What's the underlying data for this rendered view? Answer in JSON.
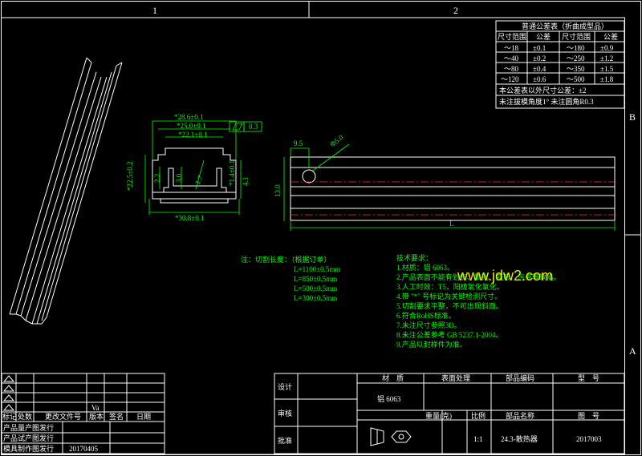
{
  "frame": {
    "zone_1": "1",
    "zone_2": "2",
    "zone_A": "A",
    "zone_B": "B"
  },
  "tolerance_table": {
    "title": "普通公差表（折曲成型品）",
    "headers": [
      "尺寸范围",
      "公差",
      "尺寸范围",
      "公差"
    ],
    "rows": [
      [
        "～18",
        "±0.1",
        "～180",
        "±0.9"
      ],
      [
        "～40",
        "±0.2",
        "～250",
        "±1.2"
      ],
      [
        "～80",
        "±0.4",
        "～350",
        "±1.5"
      ],
      [
        "～120",
        "±0.6",
        "～500",
        "±1.8"
      ]
    ],
    "note1": "本公差表以外尺寸公差：±2",
    "note2": "未注拔模角度1° 未注圆角R0.3"
  },
  "section_view": {
    "dims": [
      "*28.6±0.1",
      "*25.0±0.1",
      "*22.1±0.1",
      "*22.5±0.2",
      "2.2",
      "3.0",
      "1.7",
      "*1.4±0.1",
      "4.1",
      "*30.8±0.1"
    ],
    "flatness_value": "0.3"
  },
  "side_view": {
    "dims": [
      "9.5",
      "Φ5.0",
      "13.0",
      "L"
    ]
  },
  "cut_length": {
    "title": "注：切割长度：（根据订单）",
    "items": [
      "L=1100±0.5mm",
      "L=850±0.5mm",
      "L=500±0.5mm",
      "L=300±0.5mm"
    ]
  },
  "tech_req": {
    "title": "技术要求：",
    "items": [
      "1.材质：铝 6063。",
      "2.产品表面不能有划伤、氧化、变形、污点等缺陷。",
      "3.人工时效：T5，阳极氧化氧化。",
      "4.带 \"*\" 号标记为关键检测尺寸。",
      "5.切割要求平整，不可出现斜面。",
      "6.符合RoHS标准。",
      "7.未注尺寸参照3D。",
      "8.未注公差参考 GB 5237.1-2004。",
      "9.产品以封样件为准。"
    ]
  },
  "watermark": "www.jdw2.com",
  "revision_block": {
    "headers": [
      "标记",
      "处数",
      "更改文件号",
      "版本",
      "签名",
      "日期"
    ],
    "version": "Va",
    "rows": [
      {
        "label": "产品量产图发行",
        "date": ""
      },
      {
        "label": "产品试产图发行",
        "date": ""
      },
      {
        "label": "模具制作图发行",
        "date": "20170405"
      }
    ]
  },
  "title_block": {
    "design": "设计",
    "review": "审核",
    "approve": "批准",
    "material_h": "材　质",
    "surface_h": "表面处理",
    "part_no_h": "部品编码",
    "model_h": "型　号",
    "material_v": "铝 6063",
    "weight_h": "重量(克)",
    "scale_h": "比例",
    "part_name_h": "部品名称",
    "drawing_no_h": "图　号",
    "scale_v": "1:1",
    "part_name_v": "24.3-散热器",
    "drawing_no_v": "2017003"
  },
  "colors": {
    "line": "#ffffff",
    "dim": "#00ff00",
    "accent": "#00e5ff",
    "center": "#ff3030"
  }
}
